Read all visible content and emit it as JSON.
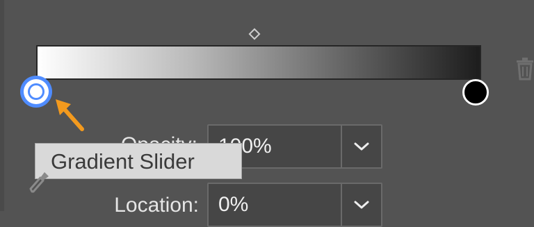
{
  "gradient": {
    "start_color": "#ffffff",
    "end_color": "#000000",
    "midpoint_location": 0.5,
    "selected_stop": "left"
  },
  "controls": {
    "opacity_label": "Opacity:",
    "opacity_value": "100%",
    "location_label": "Location:",
    "location_value": "0%"
  },
  "tooltip": {
    "text": "Gradient Slider"
  },
  "colors": {
    "panel_bg": "#535353",
    "selection_accent": "#4f8cff",
    "callout_arrow": "#f39a1e"
  },
  "icons": [
    "midpoint-diamond-icon",
    "trash-icon",
    "eyedropper-icon",
    "chevron-down-icon",
    "callout-arrow-icon"
  ]
}
